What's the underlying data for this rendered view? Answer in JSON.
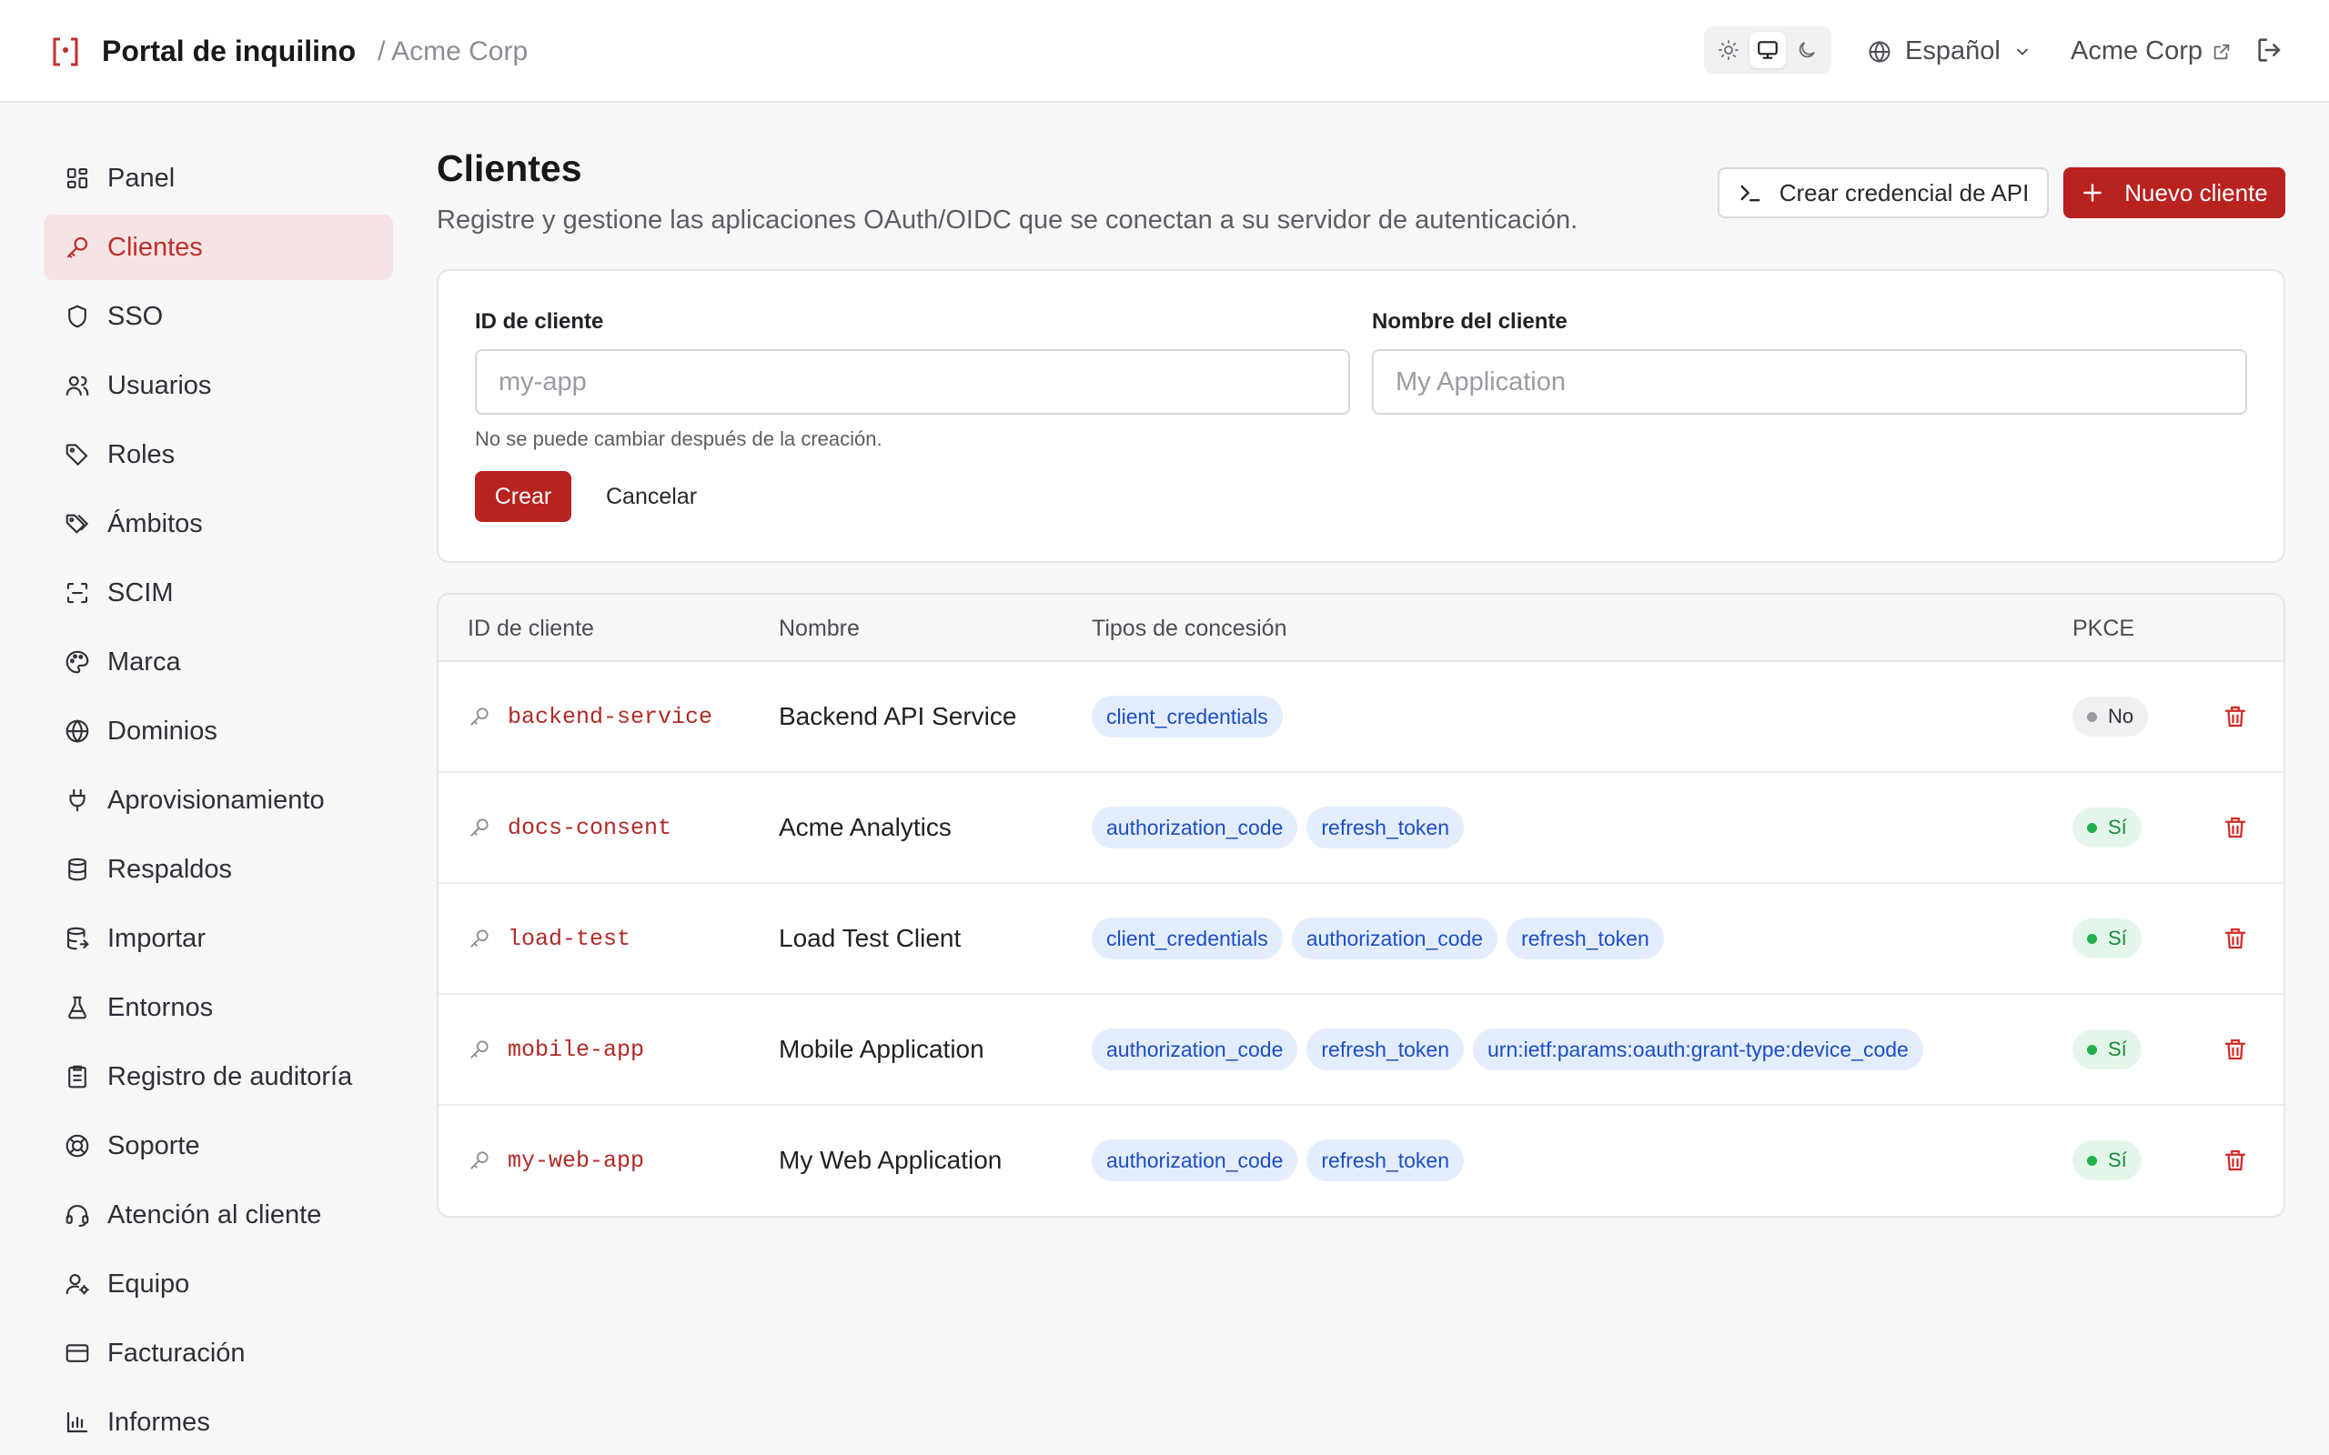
{
  "header": {
    "title": "Portal de inquilino",
    "breadcrumb": "/ Acme Corp",
    "theme_options": [
      "light",
      "system",
      "dark"
    ],
    "theme_active": "system",
    "language": "Español",
    "tenant_link": "Acme Corp"
  },
  "sidebar": {
    "items": [
      {
        "label": "Panel",
        "icon": "dashboard-icon"
      },
      {
        "label": "Clientes",
        "icon": "key-icon",
        "active": true
      },
      {
        "label": "SSO",
        "icon": "shield-icon"
      },
      {
        "label": "Usuarios",
        "icon": "users-icon"
      },
      {
        "label": "Roles",
        "icon": "tag-icon"
      },
      {
        "label": "Ámbitos",
        "icon": "tags-icon"
      },
      {
        "label": "SCIM",
        "icon": "scan-icon"
      },
      {
        "label": "Marca",
        "icon": "palette-icon"
      },
      {
        "label": "Dominios",
        "icon": "globe-icon"
      },
      {
        "label": "Aprovisionamiento",
        "icon": "plug-icon"
      },
      {
        "label": "Respaldos",
        "icon": "database-icon"
      },
      {
        "label": "Importar",
        "icon": "database-import-icon"
      },
      {
        "label": "Entornos",
        "icon": "flask-icon"
      },
      {
        "label": "Registro de auditoría",
        "icon": "clipboard-icon"
      },
      {
        "label": "Soporte",
        "icon": "lifebuoy-icon"
      },
      {
        "label": "Atención al cliente",
        "icon": "headset-icon"
      },
      {
        "label": "Equipo",
        "icon": "user-cog-icon"
      },
      {
        "label": "Facturación",
        "icon": "credit-card-icon"
      },
      {
        "label": "Informes",
        "icon": "bar-chart-icon"
      }
    ]
  },
  "page": {
    "title": "Clientes",
    "subtitle": "Registre y gestione las aplicaciones OAuth/OIDC que se conectan a su servidor de autenticación.",
    "create_api_credential_label": "Crear credencial de API",
    "new_client_label": "Nuevo cliente"
  },
  "form": {
    "client_id_label": "ID de cliente",
    "client_id_placeholder": "my-app",
    "client_id_value": "",
    "client_name_label": "Nombre del cliente",
    "client_name_placeholder": "My Application",
    "client_name_value": "",
    "client_id_hint": "No se puede cambiar después de la creación.",
    "create_label": "Crear",
    "cancel_label": "Cancelar"
  },
  "table": {
    "columns": [
      "ID de cliente",
      "Nombre",
      "Tipos de concesión",
      "PKCE"
    ],
    "rows": [
      {
        "id": "backend-service",
        "name": "Backend API Service",
        "grants": [
          "client_credentials"
        ],
        "pkce": "No",
        "pkce_enabled": false
      },
      {
        "id": "docs-consent",
        "name": "Acme Analytics",
        "grants": [
          "authorization_code",
          "refresh_token"
        ],
        "pkce": "Sí",
        "pkce_enabled": true
      },
      {
        "id": "load-test",
        "name": "Load Test Client",
        "grants": [
          "client_credentials",
          "authorization_code",
          "refresh_token"
        ],
        "pkce": "Sí",
        "pkce_enabled": true
      },
      {
        "id": "mobile-app",
        "name": "Mobile Application",
        "grants": [
          "authorization_code",
          "refresh_token",
          "urn:ietf:params:oauth:grant-type:device_code"
        ],
        "pkce": "Sí",
        "pkce_enabled": true
      },
      {
        "id": "my-web-app",
        "name": "My Web Application",
        "grants": [
          "authorization_code",
          "refresh_token"
        ],
        "pkce": "Sí",
        "pkce_enabled": true
      }
    ]
  },
  "colors": {
    "accent": "#b8221f",
    "accent_soft": "#f6e4e4",
    "chip_bg": "#e3edfd",
    "chip_text": "#1d4fc4",
    "pkce_yes": "#22b14c",
    "pkce_no": "#9a9ca2"
  }
}
